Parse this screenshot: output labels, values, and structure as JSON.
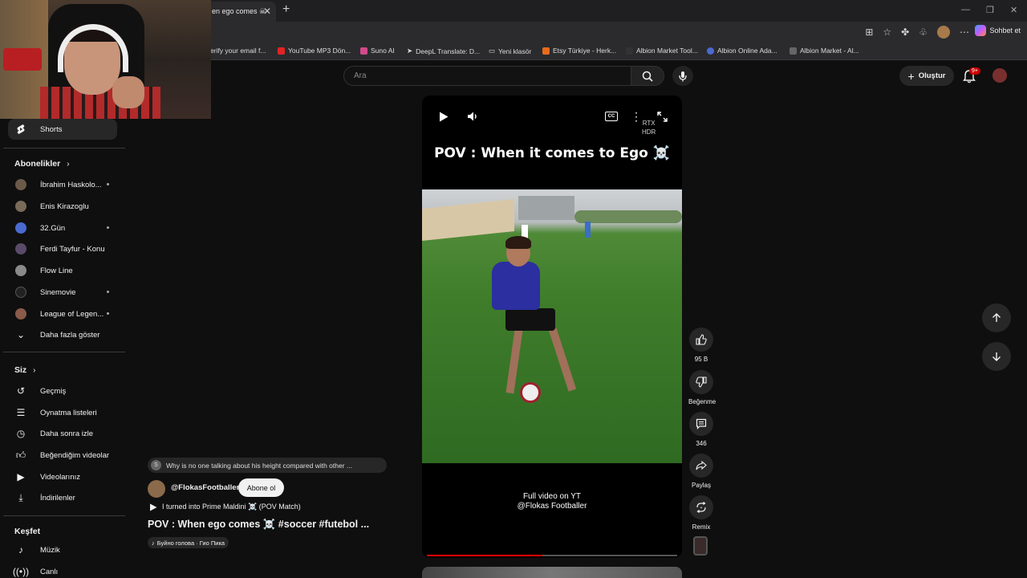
{
  "browser": {
    "tab_title": "en ego comes ☠",
    "tab_close": "✕",
    "new_tab": "+",
    "copilot_label": "Sohbet et",
    "bookmarks": [
      {
        "label": "erify your email f...",
        "color": "#444444"
      },
      {
        "label": "YouTube MP3 Dön...",
        "color": "#e02424"
      },
      {
        "label": "Suno AI",
        "color": "#d24a8a"
      },
      {
        "label": "DeepL Translate: D...",
        "color": "#555555"
      },
      {
        "label": "Yeni klasör",
        "color": "#555555"
      },
      {
        "label": "Etsy Türkiye - Herk...",
        "color": "#e86b1c"
      },
      {
        "label": "Albion Market Tool...",
        "color": "#555555"
      },
      {
        "label": "Albion Online Ada...",
        "color": "#4a6ad0"
      },
      {
        "label": "Albion Market - Al...",
        "color": "#666666"
      }
    ]
  },
  "masthead": {
    "search_placeholder": "Ara",
    "create_label": "Oluştur",
    "notification_count": "9+"
  },
  "sidebar": {
    "shorts_label": "Shorts",
    "subscriptions_header": "Abonelikler",
    "subscriptions": [
      {
        "label": "İbrahim Haskolo...",
        "color": "#6b5a48",
        "dot": true
      },
      {
        "label": "Enis Kirazoglu",
        "color": "#7a6a5a",
        "dot": false
      },
      {
        "label": "32.Gün",
        "color": "#4a6ad0",
        "dot": true
      },
      {
        "label": "Ferdi Tayfur - Konu",
        "color": "#5a4a6a",
        "dot": false
      },
      {
        "label": "Flow Line",
        "color": "#8a8a8a",
        "dot": false
      },
      {
        "label": "Sinemovie",
        "color": "#222222",
        "dot": true
      },
      {
        "label": "League of Legen...",
        "color": "#8a5a4a",
        "dot": true
      }
    ],
    "show_more": "Daha fazla göster",
    "you_header": "Siz",
    "you_items": [
      "Geçmiş",
      "Oynatma listeleri",
      "Daha sonra izle",
      "Beğendiğim videolar",
      "Videolarınız",
      "İndirilenler"
    ],
    "explore_header": "Keşfet",
    "explore_items": [
      "Müzik",
      "Canlı"
    ]
  },
  "player": {
    "title": "POV : When it comes to Ego ☠️",
    "cc_label": "CC",
    "rtx_line1": "RTX",
    "rtx_line2": "HDR",
    "caption_line1": "Full video on YT",
    "caption_line2": "@Flokas Footballer",
    "progress": 0.46
  },
  "actions": {
    "like_count": "95 B",
    "dislike_label": "Beğenme",
    "comment_count": "346",
    "share_label": "Paylaş",
    "remix_label": "Remix"
  },
  "info": {
    "comment_chip_avatar": "S",
    "comment_chip_text": "Why is no one talking about his height compared with other ...",
    "channel_name": "@FlokasFootballer",
    "subscribe_label": "Abone ol",
    "linked_video": "I turned into Prime Maldini ☠️ (POV Match)",
    "short_title": "POV : When ego comes ☠️ #soccer #futebol ...",
    "music": "Буйно голова · Гио Пика"
  }
}
